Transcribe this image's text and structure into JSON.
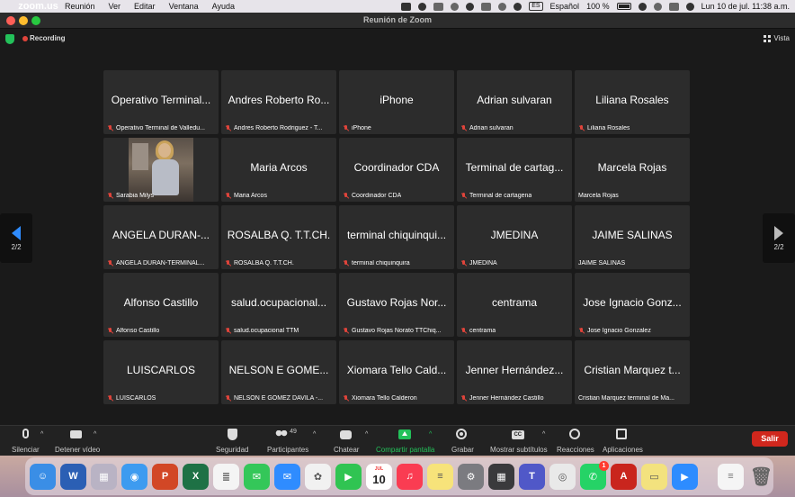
{
  "menubar": {
    "app_name": "zoom.us",
    "menus": [
      "Reunión",
      "Ver",
      "Editar",
      "Ventana",
      "Ayuda"
    ],
    "keyboard": "ES",
    "input_source": "Español",
    "battery": "100 %",
    "datetime": "Lun 10 de jul.  11:38 a.m."
  },
  "window": {
    "title": "Reunión de Zoom"
  },
  "meeting": {
    "recording_label": "Recording",
    "view_label": "Vista",
    "page_left": "2/2",
    "page_right": "2/2",
    "colors": {
      "recording": "#e0443b",
      "secure": "#23c15a",
      "muted": "#e0443b",
      "tile": "#2c2c2c"
    }
  },
  "participants": [
    {
      "display": "Operativo Terminal...",
      "name": "Operativo Terminal de Valledu...",
      "muted": true
    },
    {
      "display": "Andres Roberto Ro...",
      "name": "Andres Roberto Rodriguez - T...",
      "muted": true
    },
    {
      "display": "iPhone",
      "name": "iPhone",
      "muted": true
    },
    {
      "display": "Adrian sulvaran",
      "name": "Adrian sulvaran",
      "muted": true
    },
    {
      "display": "Liliana Rosales",
      "name": "Liliana Rosales",
      "muted": true
    },
    {
      "display": "",
      "name": "Sarabia Milys",
      "muted": true,
      "video": true
    },
    {
      "display": "Maria Arcos",
      "name": "Maria Arcos",
      "muted": true
    },
    {
      "display": "Coordinador CDA",
      "name": "Coordinador CDA",
      "muted": true
    },
    {
      "display": "Terminal de cartag...",
      "name": "Terminal de cartagena",
      "muted": true
    },
    {
      "display": "Marcela Rojas",
      "name": "Marcela Rojas",
      "muted": false
    },
    {
      "display": "ANGELA DURAN-...",
      "name": "ANGELA DURAN-TERMINAL...",
      "muted": true
    },
    {
      "display": "ROSALBA Q. T.T.CH.",
      "name": "ROSALBA Q. T.T.CH.",
      "muted": true
    },
    {
      "display": "terminal chiquinqui...",
      "name": "terminal chiquinquira",
      "muted": true
    },
    {
      "display": "JMEDINA",
      "name": "JMEDINA",
      "muted": true
    },
    {
      "display": "JAIME SALINAS",
      "name": "JAIME SALINAS",
      "muted": false
    },
    {
      "display": "Alfonso Castillo",
      "name": "Alfonso Castillo",
      "muted": true
    },
    {
      "display": "salud.ocupacional...",
      "name": "salud.ocupacional TTM",
      "muted": true
    },
    {
      "display": "Gustavo Rojas Nor...",
      "name": "Gustavo Rojas Norato TTChiq...",
      "muted": true
    },
    {
      "display": "centrama",
      "name": "centrama",
      "muted": true
    },
    {
      "display": "Jose Ignacio Gonz...",
      "name": "Jose Ignacio Gonzalez",
      "muted": true
    },
    {
      "display": "LUISCARLOS",
      "name": "LUISCARLOS",
      "muted": true
    },
    {
      "display": "NELSON E GOME...",
      "name": "NELSON E GOMEZ DAVILA -...",
      "muted": true
    },
    {
      "display": "Xiomara  Tello Cald...",
      "name": "Xiomara  Tello Calderon",
      "muted": true
    },
    {
      "display": "Jenner Hernández...",
      "name": "Jenner Hernández Castillo",
      "muted": true
    },
    {
      "display": "Cristian Marquez t...",
      "name": "Cristian Marquez terminal de Ma...",
      "muted": false
    }
  ],
  "toolbar": {
    "mute": "Silenciar",
    "stop_video": "Detener vídeo",
    "security": "Seguridad",
    "participants": "Participantes",
    "participants_count": "49",
    "chat": "Chatear",
    "share": "Compartir pantalla",
    "record": "Grabar",
    "subtitles": "Mostrar subtítulos",
    "reactions": "Reacciones",
    "apps": "Aplicaciones",
    "leave": "Salir",
    "share_color": "#23c15a",
    "leave_color": "#d0271d"
  },
  "dock": {
    "calendar_month": "JUL",
    "calendar_day": "10",
    "whatsapp_badge": "1",
    "apps": [
      {
        "icon": "finder-icon",
        "color": "#3a8ee6",
        "glyph": "☺"
      },
      {
        "icon": "word-icon",
        "color": "#2b5fb4",
        "glyph": "W"
      },
      {
        "icon": "launchpad-icon",
        "color": "#b9b3c4",
        "glyph": "▦"
      },
      {
        "icon": "safari-icon",
        "color": "#3d9bf0",
        "glyph": "◉"
      },
      {
        "icon": "powerpoint-icon",
        "color": "#d24726",
        "glyph": "P"
      },
      {
        "icon": "excel-icon",
        "color": "#1e7145",
        "glyph": "X"
      },
      {
        "icon": "reminders-icon",
        "color": "#f4f4f4",
        "glyph": "≣"
      },
      {
        "icon": "messages-icon",
        "color": "#34c759",
        "glyph": "✉"
      },
      {
        "icon": "mail-icon",
        "color": "#2f8cff",
        "glyph": "✉"
      },
      {
        "icon": "photos-icon",
        "color": "#f1f1f1",
        "glyph": "✿"
      },
      {
        "icon": "facetime-icon",
        "color": "#30c452",
        "glyph": "▶"
      },
      {
        "icon": "calendar-icon",
        "color": "#ffffff",
        "glyph": ""
      },
      {
        "icon": "music-icon",
        "color": "#fa3c52",
        "glyph": "♫"
      },
      {
        "icon": "notes-icon",
        "color": "#f7e37a",
        "glyph": "≡"
      },
      {
        "icon": "system-preferences-icon",
        "color": "#7b7b80",
        "glyph": "⚙"
      },
      {
        "icon": "calculator-icon",
        "color": "#3a3a3c",
        "glyph": "▦"
      },
      {
        "icon": "teams-icon",
        "color": "#5058c8",
        "glyph": "T"
      },
      {
        "icon": "chrome-icon",
        "color": "#e9e9e9",
        "glyph": "◎"
      },
      {
        "icon": "whatsapp-icon",
        "color": "#25d366",
        "glyph": "✆"
      },
      {
        "icon": "acrobat-icon",
        "color": "#c9251d",
        "glyph": "A"
      },
      {
        "icon": "stickies-icon",
        "color": "#f3e27e",
        "glyph": "▭"
      },
      {
        "icon": "zoom-icon",
        "color": "#2d8cff",
        "glyph": "▶"
      }
    ]
  }
}
